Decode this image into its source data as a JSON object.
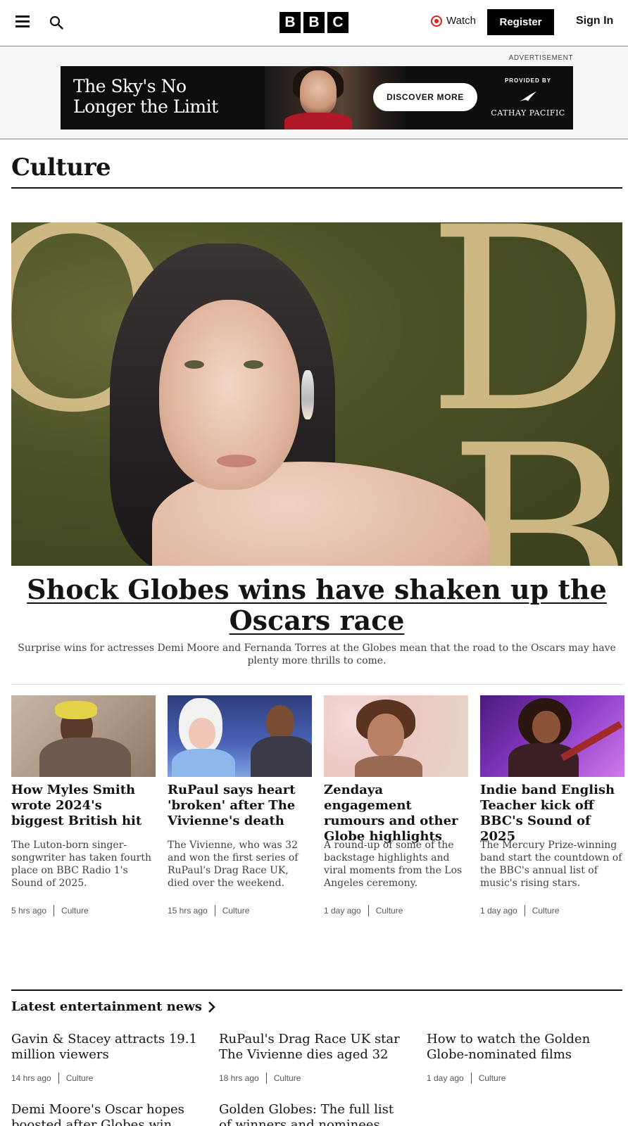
{
  "nav": {
    "watch_label": "Watch",
    "register_label": "Register",
    "signin_label": "Sign In",
    "logo_letters": [
      "B",
      "B",
      "C"
    ]
  },
  "ad": {
    "label": "ADVERTISEMENT",
    "headline": "The Sky's No Longer the Limit",
    "cta": "DISCOVER MORE",
    "provided_by": "PROVIDED BY",
    "brand": "CATHAY PACIFIC"
  },
  "section": {
    "title": "Culture"
  },
  "hero": {
    "title": "Shock Globes wins have shaken up the Oscars race",
    "description": "Surprise wins for actresses Demi Moore and Fernanda Torres at the Globes mean that the road to the Oscars may have plenty more thrills to come."
  },
  "cards": [
    {
      "title": "How Myles Smith wrote 2024's biggest British hit",
      "description": "The Luton-born singer-songwriter has taken fourth place on BBC Radio 1's Sound of 2025.",
      "time": "5 hrs ago",
      "tag": "Culture"
    },
    {
      "title": "RuPaul says heart 'broken' after The Vivienne's death",
      "description": "The Vivienne, who was 32 and won the first series of RuPaul's Drag Race UK, died over the weekend.",
      "time": "15 hrs ago",
      "tag": "Culture"
    },
    {
      "title": "Zendaya engagement rumours and other Globe highlights",
      "description": "A round-up of some of the backstage highlights and viral moments from the Los Angeles ceremony.",
      "time": "1 day ago",
      "tag": "Culture"
    },
    {
      "title": "Indie band English Teacher kick off BBC's Sound of 2025",
      "description": "The Mercury Prize-winning band start the countdown of the BBC's annual list of music's rising stars.",
      "time": "1 day ago",
      "tag": "Culture"
    }
  ],
  "latest": {
    "title": "Latest entertainment news",
    "items": [
      {
        "title": "Gavin & Stacey attracts 19.1 million viewers",
        "time": "14 hrs ago",
        "tag": "Culture"
      },
      {
        "title": "RuPaul's Drag Race UK star The Vivienne dies aged 32",
        "time": "18 hrs ago",
        "tag": "Culture"
      },
      {
        "title": "How to watch the Golden Globe-nominated films",
        "time": "1 day ago",
        "tag": "Culture"
      },
      {
        "title": "Demi Moore's Oscar hopes boosted after Globes win",
        "time": "",
        "tag": ""
      },
      {
        "title": "Golden Globes: The full list of winners and nominees",
        "time": "",
        "tag": ""
      }
    ]
  }
}
